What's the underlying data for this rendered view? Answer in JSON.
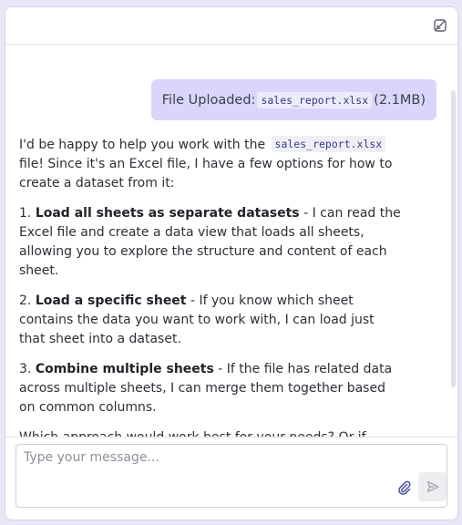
{
  "header": {
    "collapse_icon": "collapse-icon"
  },
  "user_message": {
    "prefix": "File Uploaded:",
    "filename": "sales_report.xlsx",
    "size": "(2.1MB)"
  },
  "assistant_message": {
    "intro_1": "I'd be happy to help you work with the",
    "intro_filename": "sales_report.xlsx",
    "intro_2": "file! Since it's an Excel file, I have a few options for how to create a dataset from it:",
    "options": [
      {
        "number": "1.",
        "title": "Load all sheets as separate datasets",
        "text": " - I can read the Excel file and create a data view that loads all sheets, allowing you to explore the structure and content of each sheet."
      },
      {
        "number": "2.",
        "title": "Load a specific sheet",
        "text": " - If you know which sheet contains the data you want to work with, I can load just that sheet into a dataset."
      },
      {
        "number": "3.",
        "title": "Combine multiple sheets",
        "text": " - If the file has related data across multiple sheets, I can merge them together based on common columns."
      }
    ],
    "closing": "Which approach would work best for your needs? Or if you'd like, I can start by loading all sheets so you can see what's"
  },
  "composer": {
    "placeholder": "Type your message...",
    "attach_icon": "paperclip-icon",
    "send_icon": "send-icon"
  },
  "colors": {
    "user_bubble": "#dad6fb",
    "code_text": "#353a8a",
    "background": "#e9e6f8"
  }
}
